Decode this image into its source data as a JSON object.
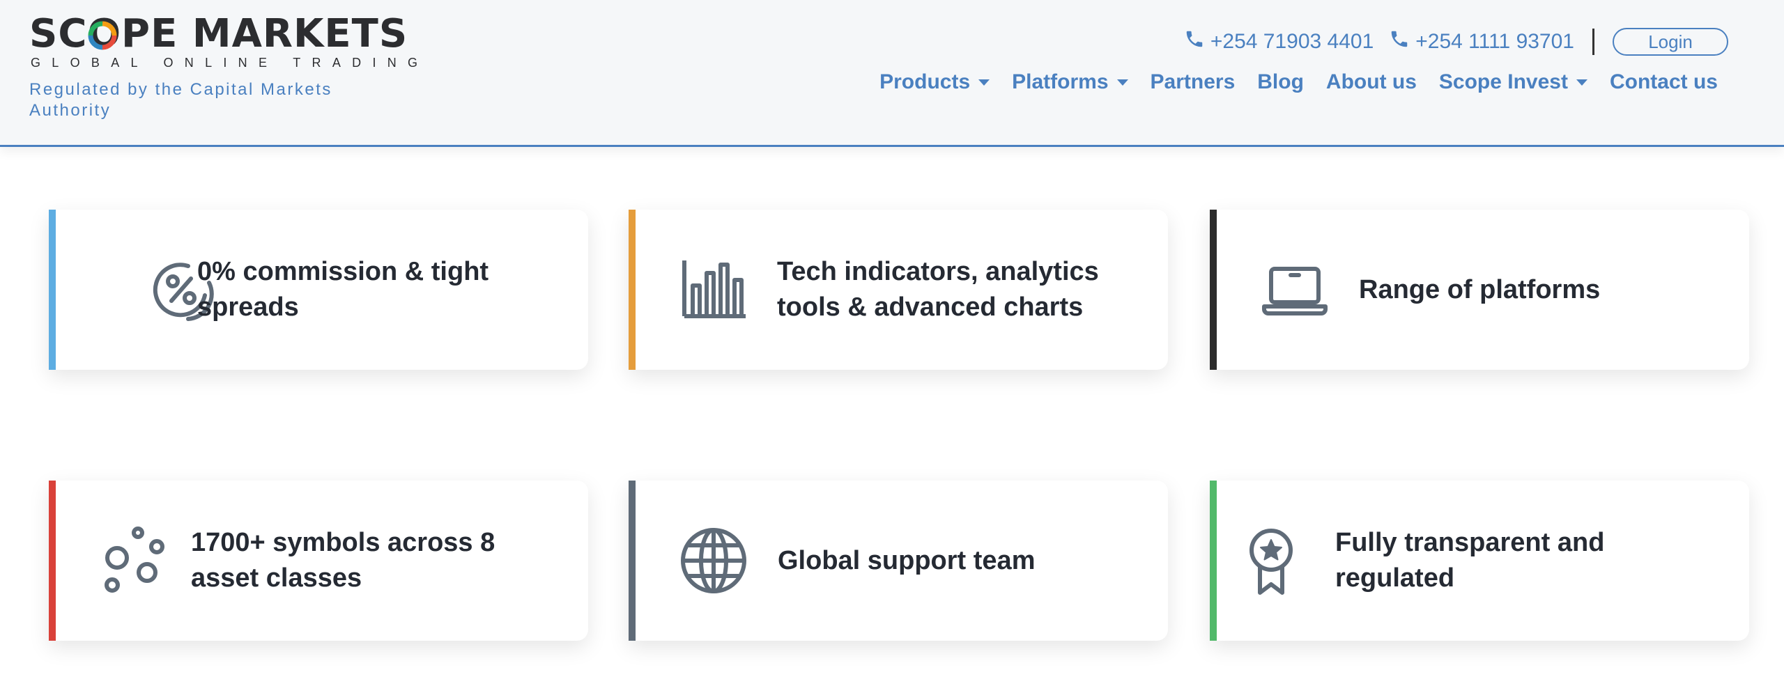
{
  "brand": {
    "name_a": "SC",
    "name_b": "PE MARKETS",
    "tagline": "GLOBAL ONLINE TRADING",
    "regulated": "Regulated by the Capital Markets Authority",
    "logo_colors": [
      "#e74c3c",
      "#2e86c1",
      "#27ae60",
      "#f39c12"
    ]
  },
  "header": {
    "phones": [
      "+254 71903 4401",
      "+254 1111 93701"
    ],
    "login_label": "Login"
  },
  "nav": {
    "items": [
      {
        "label": "Products",
        "dropdown": true
      },
      {
        "label": "Platforms",
        "dropdown": true
      },
      {
        "label": "Partners",
        "dropdown": false
      },
      {
        "label": "Blog",
        "dropdown": false
      },
      {
        "label": "About us",
        "dropdown": false
      },
      {
        "label": "Scope Invest",
        "dropdown": true
      },
      {
        "label": "Contact us",
        "dropdown": false
      }
    ]
  },
  "features": [
    {
      "title": "0% commission & tight spreads",
      "icon": "percent-icon",
      "accent": "#5dade2"
    },
    {
      "title": "Tech indicators, analytics tools & advanced charts",
      "icon": "bar-chart-icon",
      "accent": "#e59d3c"
    },
    {
      "title": "Range of platforms",
      "icon": "laptop-icon",
      "accent": "#2c2c2c"
    },
    {
      "title": "1700+ symbols across 8 asset classes",
      "icon": "bubbles-icon",
      "accent": "#d9413a"
    },
    {
      "title": "Global support team",
      "icon": "globe-icon",
      "accent": "#5f6b78"
    },
    {
      "title": "Fully transparent and regulated",
      "icon": "award-icon",
      "accent": "#52b96a"
    }
  ]
}
